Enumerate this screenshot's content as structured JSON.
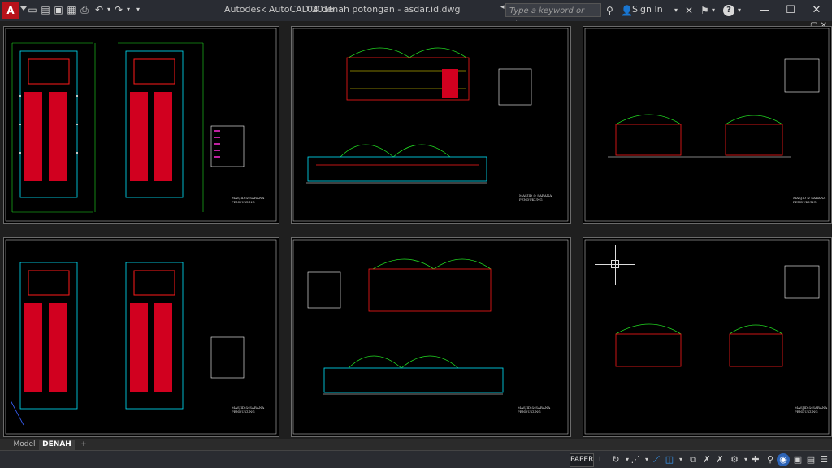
{
  "app": {
    "logo_letter": "A",
    "title": "Autodesk AutoCAD 2016",
    "document": "04 denah potongan - asdar.id.dwg"
  },
  "search": {
    "placeholder": "Type a keyword or phrase"
  },
  "user": {
    "signin_label": "Sign In"
  },
  "window_controls": {
    "minimize": "—",
    "maximize": "☐",
    "close": "✕"
  },
  "quick_access": [
    {
      "name": "new-icon",
      "glyph": "▭"
    },
    {
      "name": "open-icon",
      "glyph": "📂"
    },
    {
      "name": "save-icon",
      "glyph": "💾"
    },
    {
      "name": "saveas-icon",
      "glyph": "🖫"
    },
    {
      "name": "print-icon",
      "glyph": "⎙"
    },
    {
      "name": "undo-icon",
      "glyph": "↶"
    },
    {
      "name": "redo-icon",
      "glyph": "↷"
    }
  ],
  "sheets": [
    {
      "stamp": "MASJID & SARANA PENDUKUNG"
    },
    {
      "stamp": "MASJID & SARANA PENDUKUNG"
    },
    {
      "stamp": "MASJID & SARANA PENDUKUNG"
    },
    {
      "stamp": "MASJID & SARANA PENDUKUNG"
    },
    {
      "stamp": "MASJID & SARANA PENDUKUNG"
    },
    {
      "stamp": "MASJID & SARANA PENDUKUNG"
    }
  ],
  "layout_tabs": [
    {
      "label": "Model",
      "active": false
    },
    {
      "label": "DENAH",
      "active": true
    },
    {
      "label": "+",
      "active": false
    }
  ],
  "status_bar": {
    "space": "PAPER",
    "tools": [
      "ortho-icon",
      "polar-icon",
      "osnap-icon",
      "otrack-icon",
      "lineweight-icon",
      "transparency-icon",
      "selection-cycling-icon",
      "annotation-scale-icon",
      "workspace-gear-icon",
      "plus-icon",
      "isolate-icon",
      "hardware-accel-icon",
      "clean-screen-icon",
      "customize-icon"
    ]
  },
  "colors": {
    "paper_bg": "#000000",
    "red": "#ff1a1a",
    "green": "#22dd22",
    "cyan": "#00e5ff",
    "white": "#ffffff",
    "magenta": "#ff2bd6",
    "yellow": "#ffee00"
  }
}
